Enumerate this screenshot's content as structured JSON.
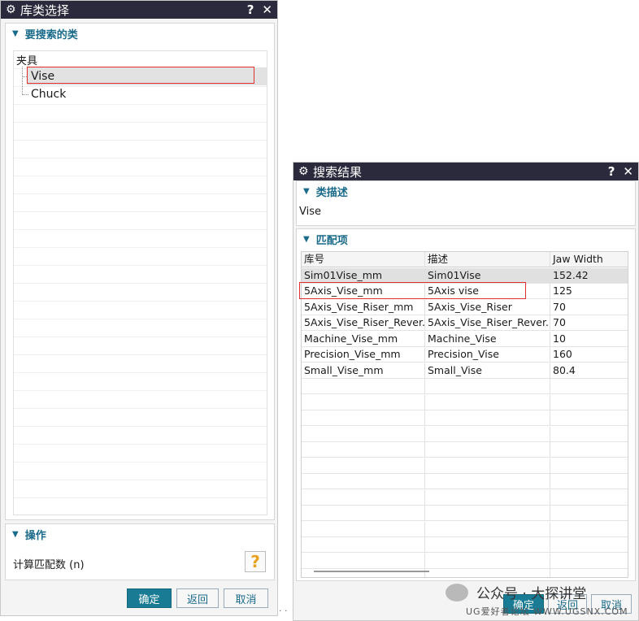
{
  "left_dialog": {
    "title": "库类选择",
    "help_label": "?",
    "close_label": "✕",
    "section_search": "要搜索的类",
    "tree_root": "夹具",
    "tree_items": [
      "Vise",
      "Chuck"
    ],
    "section_ops": "操作",
    "calc_label": "计算匹配数 (n)",
    "calc_icon": "?",
    "ok_label": "确定",
    "back_label": "返回",
    "cancel_label": "取消"
  },
  "right_dialog": {
    "title": "搜索结果",
    "help_label": "?",
    "close_label": "✕",
    "section_desc": "类描述",
    "desc_value": "Vise",
    "section_match": "匹配项",
    "columns": [
      "库号",
      "描述",
      "Jaw Width"
    ],
    "rows": [
      [
        "Sim01Vise_mm",
        "Sim01Vise",
        "152.42"
      ],
      [
        "5Axis_Vise_mm",
        "5Axis vise",
        "125"
      ],
      [
        "5Axis_Vise_Riser_mm",
        "5Axis_Vise_Riser",
        "70"
      ],
      [
        "5Axis_Vise_Riser_Rever...",
        "5Axis_Vise_Riser_Rever...",
        "70"
      ],
      [
        "Machine_Vise_mm",
        "Machine_Vise",
        "10"
      ],
      [
        "Precision_Vise_mm",
        "Precision_Vise",
        "160"
      ],
      [
        "Small_Vise_mm",
        "Small_Vise",
        "80.4"
      ]
    ],
    "ok_label": "确定",
    "back_label": "返回",
    "cancel_label": "取消"
  },
  "watermark": {
    "text": "公众号 · 大探讲堂",
    "site": "UG爱好者论坛 WWW.UGSNX.COM"
  },
  "dots": ". ."
}
